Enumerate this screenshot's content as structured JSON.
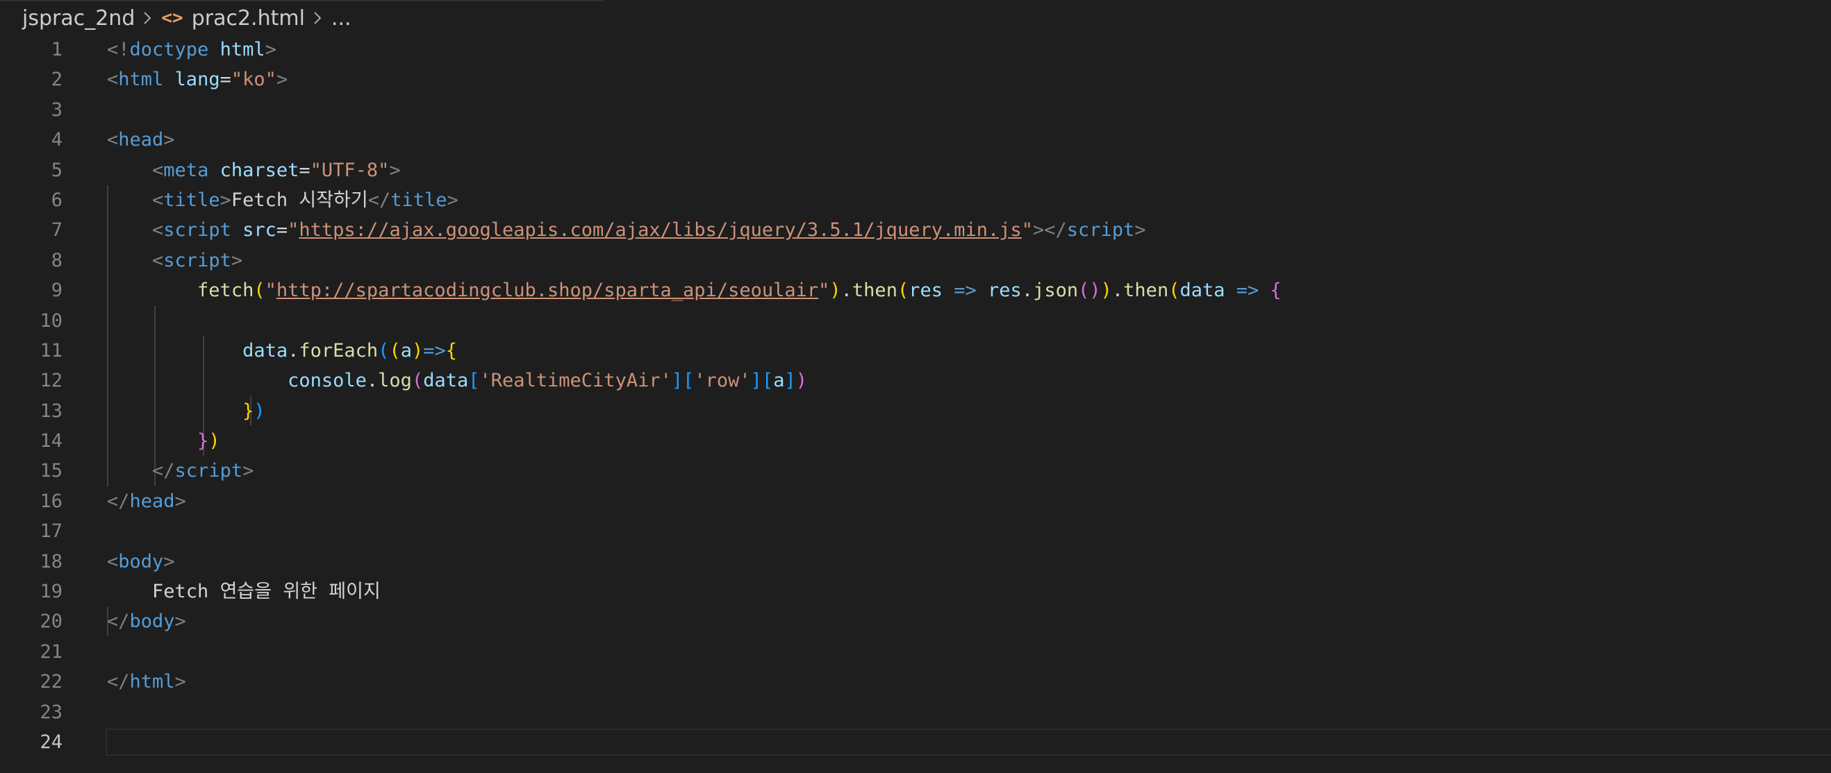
{
  "breadcrumb": {
    "folder": "jsprac_2nd",
    "file_icon": "<>",
    "file": "prac2.html",
    "more": "..."
  },
  "gutter": [
    "1",
    "2",
    "3",
    "4",
    "5",
    "6",
    "7",
    "8",
    "9",
    "10",
    "11",
    "12",
    "13",
    "14",
    "15",
    "16",
    "17",
    "18",
    "19",
    "20",
    "21",
    "22",
    "23",
    "24"
  ],
  "code": {
    "l1": {
      "lt": "<!",
      "kw": "doctype",
      "name": " html",
      "gt": ">"
    },
    "l2": {
      "lt": "<",
      "tag": "html",
      "attr": " lang",
      "eq": "=",
      "val": "\"ko\"",
      "gt": ">"
    },
    "l4": {
      "lt": "<",
      "tag": "head",
      "gt": ">"
    },
    "l5": {
      "indent": "    ",
      "lt": "<",
      "tag": "meta",
      "attr": " charset",
      "eq": "=",
      "val": "\"UTF-8\"",
      "gt": ">"
    },
    "l6": {
      "indent": "    ",
      "lt": "<",
      "tag": "title",
      "gt": ">",
      "text": "Fetch 시작하기",
      "lt2": "</",
      "tag2": "title",
      "gt2": ">"
    },
    "l7": {
      "indent": "    ",
      "lt": "<",
      "tag": "script",
      "attr": " src",
      "eq": "=",
      "q1": "\"",
      "url": "https://ajax.googleapis.com/ajax/libs/jquery/3.5.1/jquery.min.js",
      "q2": "\"",
      "gt": ">",
      "lt2": "</",
      "tag2": "script",
      "gt2": ">"
    },
    "l8": {
      "indent": "    ",
      "lt": "<",
      "tag": "script",
      "gt": ">"
    },
    "l9": {
      "indent": "        ",
      "fn": "fetch",
      "p1": "(",
      "q1": "\"",
      "url": "http://spartacodingclub.shop/sparta_api/seoulair",
      "q2": "\"",
      "p2": ")",
      "dot1": ".",
      "then1": "then",
      "p3": "(",
      "res1": "res",
      "arrow1": " => ",
      "res2": "res",
      "dot2": ".",
      "json": "json",
      "p4": "(",
      "p5": ")",
      "p6": ")",
      "dot3": ".",
      "then2": "then",
      "p7": "(",
      "data": "data",
      "arrow2": " => ",
      "brace": "{"
    },
    "l11": {
      "indent": "            ",
      "data": "data",
      "dot": ".",
      "fn": "forEach",
      "p1": "(",
      "p2": "(",
      "a": "a",
      "p3": ")",
      "arrow": "=>",
      "brace": "{"
    },
    "l12": {
      "indent": "                ",
      "console": "console",
      "dot": ".",
      "log": "log",
      "p1": "(",
      "data": "data",
      "b1": "[",
      "s1": "'RealtimeCityAir'",
      "b2": "]",
      "b3": "[",
      "s2": "'row'",
      "b4": "]",
      "b5": "[",
      "a": "a",
      "b6": "]",
      "p2": ")"
    },
    "l13": {
      "indent": "            ",
      "brace": "}",
      "p": ")"
    },
    "l14": {
      "indent": "        ",
      "brace": "}",
      "p": ")"
    },
    "l15": {
      "indent": "    ",
      "lt": "</",
      "tag": "script",
      "gt": ">"
    },
    "l16": {
      "lt": "</",
      "tag": "head",
      "gt": ">"
    },
    "l18": {
      "lt": "<",
      "tag": "body",
      "gt": ">"
    },
    "l19": {
      "indent": "    ",
      "text": "Fetch 연습을 위한 페이지"
    },
    "l20": {
      "lt": "</",
      "tag": "body",
      "gt": ">"
    },
    "l22": {
      "lt": "</",
      "tag": "html",
      "gt": ">"
    }
  },
  "colors": {
    "background": "#1e1e1e",
    "tag": "#569cd6",
    "attribute": "#9cdcfe",
    "string": "#ce9178",
    "function": "#dcdcaa",
    "bracket_gold": "#ffd700",
    "bracket_orchid": "#da70d6",
    "bracket_blue": "#179fff",
    "line_number": "#858585"
  }
}
